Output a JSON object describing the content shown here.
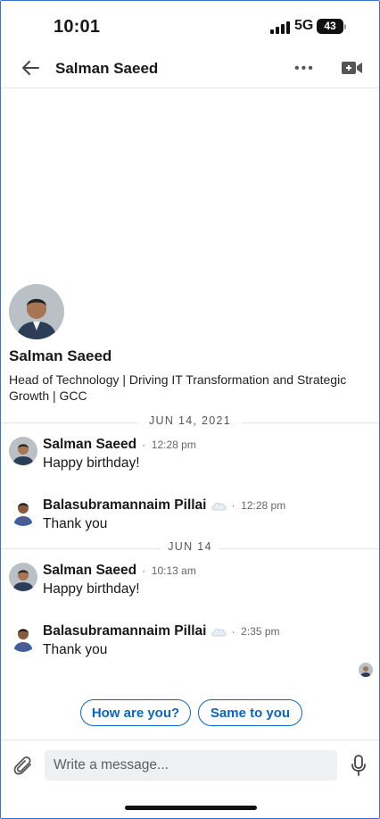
{
  "status_bar": {
    "time": "10:01",
    "network": "5G",
    "battery": "43"
  },
  "header": {
    "title": "Salman Saeed",
    "more_icon": "ellipsis-icon",
    "video_icon": "video-call-icon"
  },
  "profile": {
    "name": "Salman Saeed",
    "headline": "Head of Technology | Driving IT Transformation and Strategic Growth | GCC"
  },
  "conversation": [
    {
      "type": "date",
      "label": "JUN 14, 2021"
    },
    {
      "type": "message",
      "sender": "Salman Saeed",
      "time": "12:28 pm",
      "text": "Happy birthday!"
    },
    {
      "type": "message",
      "sender": "Balasubramannaim Pillai",
      "time": "12:28 pm",
      "text": "Thank you"
    },
    {
      "type": "date",
      "label": "JUN 14"
    },
    {
      "type": "message",
      "sender": "Salman Saeed",
      "time": "10:13 am",
      "text": "Happy birthday!"
    },
    {
      "type": "message",
      "sender": "Balasubramannaim Pillai",
      "time": "2:35 pm",
      "text": "Thank you"
    }
  ],
  "suggestions": [
    "How are you?",
    "Same to you"
  ],
  "composer": {
    "placeholder": "Write a message..."
  },
  "colors": {
    "accent": "#0a66c2",
    "divider": "#e3e3e3",
    "input_bg": "#eef0f2"
  }
}
